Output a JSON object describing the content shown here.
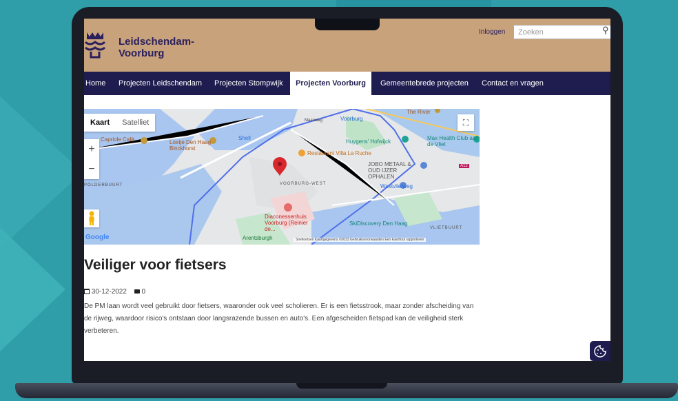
{
  "header": {
    "site_title": "Leidschendam-Voorburg"
  },
  "top": {
    "login": "Inloggen",
    "search_placeholder": "Zoeken"
  },
  "nav": {
    "items": [
      {
        "label": "Home"
      },
      {
        "label": "Projecten Leidschendam"
      },
      {
        "label": "Projecten Stompwijk"
      },
      {
        "label": "Projecten Voorburg"
      },
      {
        "label": "Gemeentebrede projecten"
      },
      {
        "label": "Contact en vragen"
      }
    ],
    "active": "Projecten Voorburg"
  },
  "map": {
    "toggle_map": "Kaart",
    "toggle_satellite": "Satelliet",
    "zoom_in": "+",
    "zoom_out": "−",
    "labels": {
      "capriole": "Capriole Café",
      "loetje": "Loetje Den Haag Binckhorst",
      "shell": "Shell",
      "villa": "Restaurant Villa La Ruche",
      "huygens": "Huygens' Hofwijck",
      "max": "Max Health Club aan de Vliet",
      "jobo": "JOBO METAAL & OUD IJZER OPHALEN",
      "westvliet": "Westvlietweg",
      "voorburgwest": "VOORBURG-WEST",
      "diacones": "Diaconessenhuis Voorburg (Reinier de...",
      "skidisc": "SkiDiscovery Den Haag",
      "vlietbuurt": "VLIETBUURT",
      "arents": "Arentsburgh",
      "theriver": "The River",
      "voorburgst": "Voorburg",
      "polderbuurt": "POLDERBUURT",
      "a12": "A12",
      "maanweg": "Maanweg",
      "google": "Google"
    },
    "attribution": "Sneltoetsen   Kaartgegevens ©2023   Gebruiksvoorwaarden   Een kaartfout rapporteren"
  },
  "post": {
    "title": "Veiliger voor fietsers",
    "date": "30-12-2022",
    "comments": "0",
    "body": "De PM laan wordt veel gebruikt door fietsers, waaronder ook veel scholieren. Er is een fietsstrook, maar zonder afscheiding van de rijweg, waardoor risico's ontstaan door langsrazende bussen en auto's. Een afgescheiden fietspad kan de veiligheid sterk verbeteren."
  },
  "colors": {
    "brand_tan": "#c8a27a",
    "brand_navy": "#1f1d4f",
    "background_teal": "#2f9ea8"
  }
}
